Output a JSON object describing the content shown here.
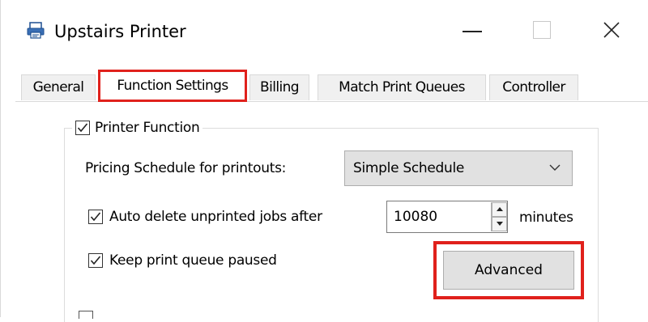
{
  "window": {
    "title": "Upstairs Printer",
    "icon": "printer-icon"
  },
  "tabs": [
    {
      "label": "General"
    },
    {
      "label": "Function Settings",
      "active": true
    },
    {
      "label": "Billing"
    },
    {
      "label": "Match Print Queues"
    },
    {
      "label": "Controller"
    }
  ],
  "printer_function": {
    "label": "Printer Function",
    "checked": true,
    "pricing_label": "Pricing Schedule for printouts:",
    "pricing_value": "Simple Schedule",
    "auto_delete_label": "Auto delete unprinted jobs after",
    "auto_delete_checked": true,
    "auto_delete_value": "10080",
    "auto_delete_unit": "minutes",
    "keep_paused_label": "Keep print queue paused",
    "keep_paused_checked": true,
    "advanced_label": "Advanced"
  },
  "colors": {
    "highlight": "#e0211c"
  }
}
